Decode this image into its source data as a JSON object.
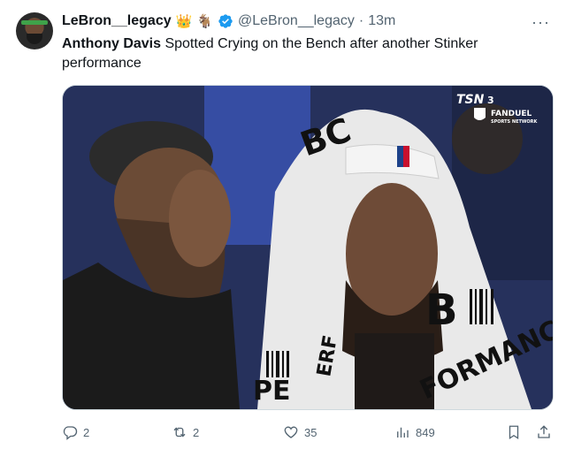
{
  "author": {
    "display_name": "LeBron__legacy",
    "crown_emoji": "👑",
    "goat_emoji": "🐐",
    "handle": "@LeBron__legacy",
    "separator": "·",
    "time": "13m"
  },
  "tweet": {
    "mention": "Anthony Davis",
    "text": " Spotted Crying on the Bench after another Stinker performance"
  },
  "media": {
    "watermark_line1": "TSN",
    "watermark_line2": "3",
    "watermark_brand": "FANDUEL",
    "watermark_sub": "SPORTS NETWORK",
    "towel_text": [
      "BC",
      "PE",
      "FORMANCE",
      "ERF",
      "B"
    ]
  },
  "actions": {
    "replies": "2",
    "reposts": "2",
    "likes": "35",
    "views": "849"
  },
  "colors": {
    "verified": "#1d9bf0",
    "muted": "#536471"
  }
}
